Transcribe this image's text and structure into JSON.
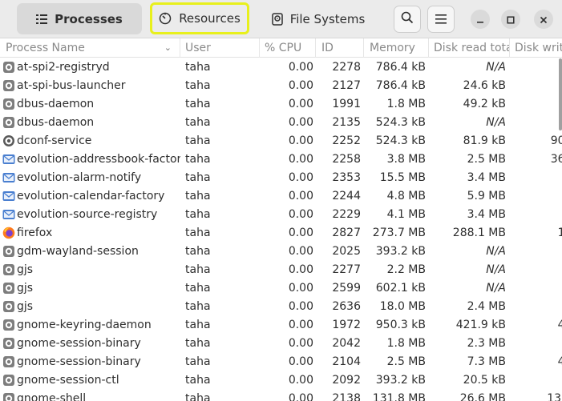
{
  "header": {
    "tabs": [
      {
        "label": "Processes",
        "icon": "process-list-icon",
        "active": true
      },
      {
        "label": "Resources",
        "icon": "gauge-icon",
        "active": false
      },
      {
        "label": "File Systems",
        "icon": "disk-icon",
        "active": false
      }
    ],
    "highlight_color": "#e8f01c"
  },
  "columns": {
    "name": "Process Name",
    "user": "User",
    "cpu": "% CPU",
    "id": "ID",
    "memory": "Memory",
    "disk_read": "Disk read tota",
    "disk_write": "Disk writ"
  },
  "rows": [
    {
      "icon": "gear-icon",
      "name": "at-spi2-registryd",
      "user": "taha",
      "cpu": "0.00",
      "id": "2278",
      "memory": "786.4 kB",
      "disk_read": "N/A",
      "disk_write": ""
    },
    {
      "icon": "gear-icon",
      "name": "at-spi-bus-launcher",
      "user": "taha",
      "cpu": "0.00",
      "id": "2127",
      "memory": "786.4 kB",
      "disk_read": "24.6 kB",
      "disk_write": ""
    },
    {
      "icon": "gear-icon",
      "name": "dbus-daemon",
      "user": "taha",
      "cpu": "0.00",
      "id": "1991",
      "memory": "1.8 MB",
      "disk_read": "49.2 kB",
      "disk_write": ""
    },
    {
      "icon": "gear-icon",
      "name": "dbus-daemon",
      "user": "taha",
      "cpu": "0.00",
      "id": "2135",
      "memory": "524.3 kB",
      "disk_read": "N/A",
      "disk_write": ""
    },
    {
      "icon": "dconf-icon",
      "name": "dconf-service",
      "user": "taha",
      "cpu": "0.00",
      "id": "2252",
      "memory": "524.3 kB",
      "disk_read": "81.9 kB",
      "disk_write": "90."
    },
    {
      "icon": "mail-icon",
      "name": "evolution-addressbook-factory",
      "user": "taha",
      "cpu": "0.00",
      "id": "2258",
      "memory": "3.8 MB",
      "disk_read": "2.5 MB",
      "disk_write": "36."
    },
    {
      "icon": "mail-icon",
      "name": "evolution-alarm-notify",
      "user": "taha",
      "cpu": "0.00",
      "id": "2353",
      "memory": "15.5 MB",
      "disk_read": "3.4 MB",
      "disk_write": ""
    },
    {
      "icon": "mail-icon",
      "name": "evolution-calendar-factory",
      "user": "taha",
      "cpu": "0.00",
      "id": "2244",
      "memory": "4.8 MB",
      "disk_read": "5.9 MB",
      "disk_write": ""
    },
    {
      "icon": "mail-icon",
      "name": "evolution-source-registry",
      "user": "taha",
      "cpu": "0.00",
      "id": "2229",
      "memory": "4.1 MB",
      "disk_read": "3.4 MB",
      "disk_write": ""
    },
    {
      "icon": "firefox-icon",
      "name": "firefox",
      "user": "taha",
      "cpu": "0.00",
      "id": "2827",
      "memory": "273.7 MB",
      "disk_read": "288.1 MB",
      "disk_write": "1."
    },
    {
      "icon": "gear-icon",
      "name": "gdm-wayland-session",
      "user": "taha",
      "cpu": "0.00",
      "id": "2025",
      "memory": "393.2 kB",
      "disk_read": "N/A",
      "disk_write": ""
    },
    {
      "icon": "gear-icon",
      "name": "gjs",
      "user": "taha",
      "cpu": "0.00",
      "id": "2277",
      "memory": "2.2 MB",
      "disk_read": "N/A",
      "disk_write": ""
    },
    {
      "icon": "gear-icon",
      "name": "gjs",
      "user": "taha",
      "cpu": "0.00",
      "id": "2599",
      "memory": "602.1 kB",
      "disk_read": "N/A",
      "disk_write": ""
    },
    {
      "icon": "gear-icon",
      "name": "gjs",
      "user": "taha",
      "cpu": "0.00",
      "id": "2636",
      "memory": "18.0 MB",
      "disk_read": "2.4 MB",
      "disk_write": ""
    },
    {
      "icon": "gear-icon",
      "name": "gnome-keyring-daemon",
      "user": "taha",
      "cpu": "0.00",
      "id": "1972",
      "memory": "950.3 kB",
      "disk_read": "421.9 kB",
      "disk_write": "4."
    },
    {
      "icon": "gear-icon",
      "name": "gnome-session-binary",
      "user": "taha",
      "cpu": "0.00",
      "id": "2042",
      "memory": "1.8 MB",
      "disk_read": "2.3 MB",
      "disk_write": ""
    },
    {
      "icon": "gear-icon",
      "name": "gnome-session-binary",
      "user": "taha",
      "cpu": "0.00",
      "id": "2104",
      "memory": "2.5 MB",
      "disk_read": "7.3 MB",
      "disk_write": "4."
    },
    {
      "icon": "gear-icon",
      "name": "gnome-session-ctl",
      "user": "taha",
      "cpu": "0.00",
      "id": "2092",
      "memory": "393.2 kB",
      "disk_read": "20.5 kB",
      "disk_write": ""
    },
    {
      "icon": "gear-icon",
      "name": "gnome-shell",
      "user": "taha",
      "cpu": "0.00",
      "id": "2138",
      "memory": "131.8 MB",
      "disk_read": "26.6 MB",
      "disk_write": "135"
    }
  ]
}
